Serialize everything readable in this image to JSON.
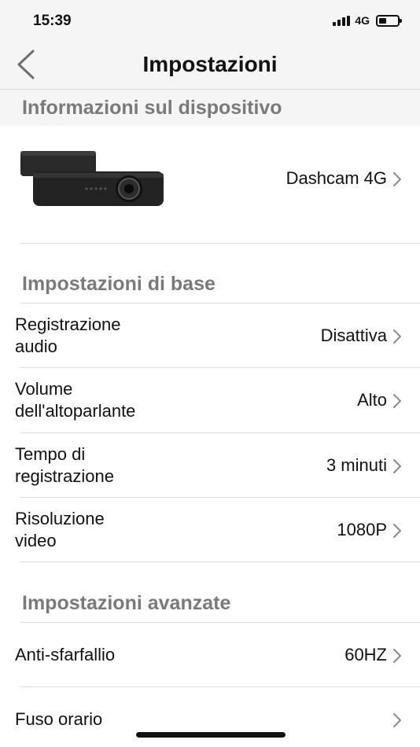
{
  "status": {
    "time": "15:39",
    "network": "4G"
  },
  "nav": {
    "title": "Impostazioni"
  },
  "sections": {
    "device_info": "Informazioni sul dispositivo",
    "basic": "Impostazioni di base",
    "advanced": "Impostazioni avanzate"
  },
  "device": {
    "name": "Dashcam 4G"
  },
  "basic_settings": [
    {
      "label_line1": "Registrazione",
      "label_line2": "audio",
      "value": "Disattiva"
    },
    {
      "label_line1": "Volume",
      "label_line2": "dell'altoparlante",
      "value": "Alto"
    },
    {
      "label_line1": "Tempo di",
      "label_line2": "registrazione",
      "value": "3 minuti"
    },
    {
      "label_line1": "Risoluzione",
      "label_line2": "video",
      "value": "1080P"
    }
  ],
  "advanced_settings": [
    {
      "label": "Anti-sfarfallio",
      "value": "60HZ"
    },
    {
      "label": "Fuso orario",
      "value": ""
    }
  ],
  "icons": {
    "back": "chevron-left-icon",
    "disclosure": "chevron-right-icon",
    "signal": "cellular-signal-icon",
    "battery": "battery-icon"
  },
  "colors": {
    "section_text": "#7a7a7a",
    "section_bg": "#f5f5f5",
    "divider": "#dcdcdc"
  }
}
